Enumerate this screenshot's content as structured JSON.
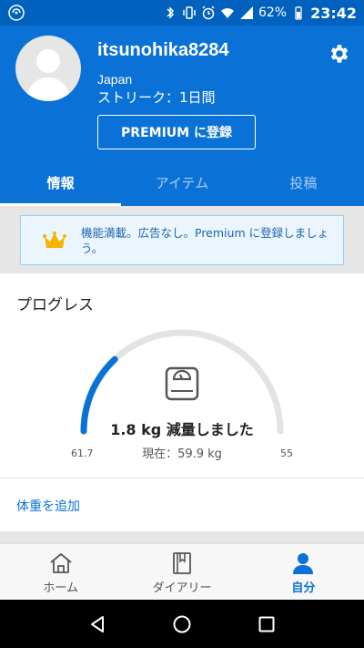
{
  "status_bar": {
    "battery": "62%",
    "time": "23:42"
  },
  "profile": {
    "username": "itsunohika8284",
    "country": "Japan",
    "streak": "ストリーク：1日間",
    "premium_button": "PREMIUM に登録"
  },
  "tabs": [
    {
      "label": "情報",
      "active": true
    },
    {
      "label": "アイテム",
      "active": false
    },
    {
      "label": "投稿",
      "active": false
    }
  ],
  "promo": {
    "text": "機能満載。広告なし。Premium に登録しましょう。"
  },
  "progress": {
    "title": "プログレス",
    "loss_text": "1.8 kg 減量しました",
    "current_text": "現在：59.9 kg",
    "start_label": "61.7",
    "goal_label": "55",
    "progress_fraction": 0.26,
    "add_weight_link": "体重を追加"
  },
  "bottom_nav": [
    {
      "label": "ホーム",
      "icon": "home-icon",
      "active": false
    },
    {
      "label": "ダイアリー",
      "icon": "book-icon",
      "active": false
    },
    {
      "label": "自分",
      "icon": "person-icon",
      "active": true
    }
  ],
  "colors": {
    "header_blue": "#0a72d6",
    "status_blue": "#0061bf",
    "accent": "#0a72d6",
    "crown": "#f5b400"
  }
}
